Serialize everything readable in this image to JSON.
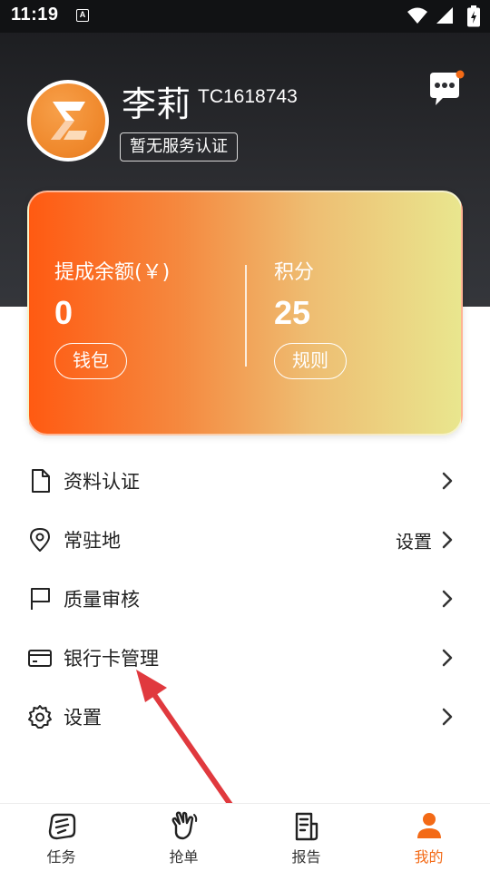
{
  "status_bar": {
    "time": "11:19",
    "badge_letter": "A",
    "icons": [
      "wifi-icon",
      "signal-icon",
      "battery-icon"
    ]
  },
  "profile": {
    "name": "李莉",
    "user_id": "TC1618743",
    "cert_status": "暂无服务认证",
    "avatar_icon": "sigma-logo-icon",
    "message_icon": "chat-bubble-icon",
    "has_unread": true
  },
  "balance_card": {
    "balance_label": "提成余额(￥)",
    "balance_value": "0",
    "wallet_button": "钱包",
    "points_label": "积分",
    "points_value": "25",
    "rules_button": "规则"
  },
  "menu": {
    "items": [
      {
        "label": "资料认证",
        "icon": "document-icon",
        "extra": ""
      },
      {
        "label": "常驻地",
        "icon": "location-pin-icon",
        "extra": "设置"
      },
      {
        "label": "质量审核",
        "icon": "flag-icon",
        "extra": ""
      },
      {
        "label": "银行卡管理",
        "icon": "bank-card-icon",
        "extra": ""
      },
      {
        "label": "设置",
        "icon": "gear-icon",
        "extra": ""
      }
    ]
  },
  "bottom_nav": {
    "items": [
      {
        "label": "任务",
        "icon": "task-icon",
        "active": false
      },
      {
        "label": "抢单",
        "icon": "grab-hand-icon",
        "active": false
      },
      {
        "label": "报告",
        "icon": "report-icon",
        "active": false
      },
      {
        "label": "我的",
        "icon": "person-icon",
        "active": true
      }
    ]
  },
  "colors": {
    "accent": "#f36a16",
    "header_dark": "#2c2d31",
    "card_gradient_start": "#ff5a12",
    "card_gradient_end": "#e9e68e",
    "annotation_arrow": "#e0393e",
    "unread_dot": "#f36a16"
  }
}
